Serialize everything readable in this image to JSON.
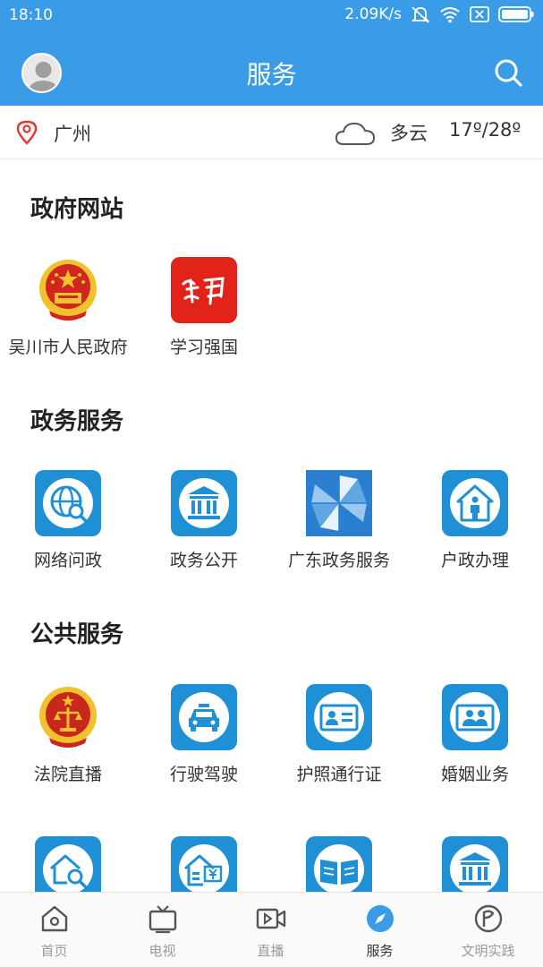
{
  "status": {
    "time": "18:10",
    "speed": "2.09K/s"
  },
  "header": {
    "title": "服务"
  },
  "location": {
    "city": "广州",
    "weather": "多云",
    "temperature": "17º/28º"
  },
  "sections": [
    {
      "title": "政府网站",
      "items": [
        {
          "label": "吴川市人民政府",
          "icon": "national-emblem-icon"
        },
        {
          "label": "学习强国",
          "icon": "xuexi-logo-icon"
        }
      ]
    },
    {
      "title": "政务服务",
      "items": [
        {
          "label": "网络问政",
          "icon": "globe-search-icon"
        },
        {
          "label": "政务公开",
          "icon": "government-building-icon"
        },
        {
          "label": "广东政务服务",
          "icon": "pinwheel-icon"
        },
        {
          "label": "户政办理",
          "icon": "house-person-icon"
        }
      ]
    },
    {
      "title": "公共服务",
      "items": [
        {
          "label": "法院直播",
          "icon": "court-emblem-icon"
        },
        {
          "label": "行驶驾驶",
          "icon": "car-icon"
        },
        {
          "label": "护照通行证",
          "icon": "id-card-icon"
        },
        {
          "label": "婚姻业务",
          "icon": "couple-icon"
        }
      ]
    },
    {
      "title": "",
      "items": [
        {
          "label": "",
          "icon": "house-search-icon"
        },
        {
          "label": "",
          "icon": "house-fund-icon"
        },
        {
          "label": "",
          "icon": "open-book-icon"
        },
        {
          "label": "",
          "icon": "government-building-icon"
        }
      ]
    }
  ],
  "nav": [
    {
      "label": "首页",
      "icon": "home-icon",
      "active": false
    },
    {
      "label": "电视",
      "icon": "tv-icon",
      "active": false
    },
    {
      "label": "直播",
      "icon": "video-play-icon",
      "active": false
    },
    {
      "label": "服务",
      "icon": "compass-icon",
      "active": true
    },
    {
      "label": "文明实践",
      "icon": "flag-circle-icon",
      "active": false
    }
  ],
  "colors": {
    "brand": "#3a9be6",
    "icon_blue": "#1f8fd6",
    "active_nav": "#3a9be6",
    "emblem_red": "#d0261f",
    "emblem_gold": "#f2c12e"
  }
}
